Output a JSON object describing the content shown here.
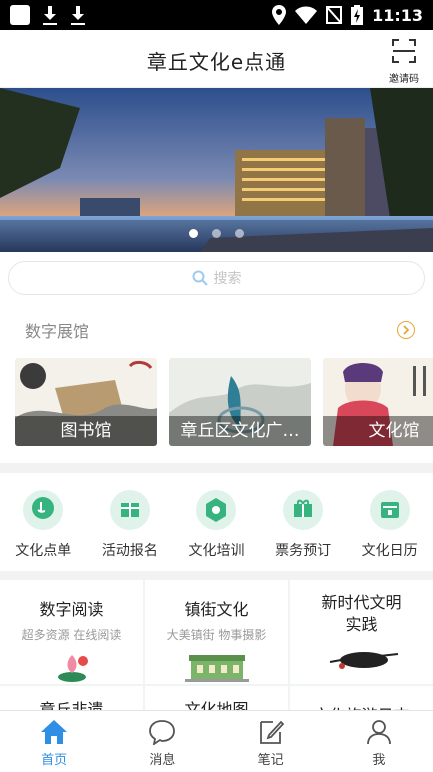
{
  "status_bar": {
    "time": "11:13",
    "icons": [
      "app-notification-icon",
      "download-icon",
      "download-icon",
      "location-icon",
      "wifi-icon",
      "no-sim-icon",
      "battery-charging-icon"
    ]
  },
  "header": {
    "title": "章丘文化e点通",
    "invite_label": "邀请码",
    "invite_icon": "scan-icon"
  },
  "banner": {
    "slide_count": 3,
    "active_index": 0
  },
  "search": {
    "placeholder": "搜索",
    "icon": "search-icon"
  },
  "digital_gallery": {
    "title": "数字展馆",
    "more_icon": "chevron-right-icon",
    "items": [
      {
        "label": "图书馆"
      },
      {
        "label": "章丘区文化广…"
      },
      {
        "label": "文化馆"
      }
    ]
  },
  "functions": [
    {
      "label": "文化点单",
      "icon": "tap-icon"
    },
    {
      "label": "活动报名",
      "icon": "gift-icon"
    },
    {
      "label": "文化培训",
      "icon": "training-icon"
    },
    {
      "label": "票务预订",
      "icon": "ticket-gift-icon"
    },
    {
      "label": "文化日历",
      "icon": "calendar-icon"
    }
  ],
  "grid": [
    {
      "title": "数字阅读",
      "subtitle": "超多资源  在线阅读"
    },
    {
      "title": "镇街文化",
      "subtitle": "大美镇街  物事摄影"
    },
    {
      "title": "新时代文明\n实践",
      "subtitle": ""
    },
    {
      "title": "章丘非遗",
      "subtitle": ""
    },
    {
      "title": "文化地图",
      "subtitle": ""
    },
    {
      "title": "文化旅游日志",
      "subtitle": ""
    }
  ],
  "tabs": [
    {
      "label": "首页",
      "icon": "home-icon",
      "active": true
    },
    {
      "label": "消息",
      "icon": "message-icon",
      "active": false
    },
    {
      "label": "笔记",
      "icon": "note-icon",
      "active": false
    },
    {
      "label": "我",
      "icon": "profile-icon",
      "active": false
    }
  ],
  "colors": {
    "accent": "#2f8fe6",
    "mint": "#dff3ea",
    "mint_dark": "#36b37e",
    "orange": "#e8a838"
  }
}
